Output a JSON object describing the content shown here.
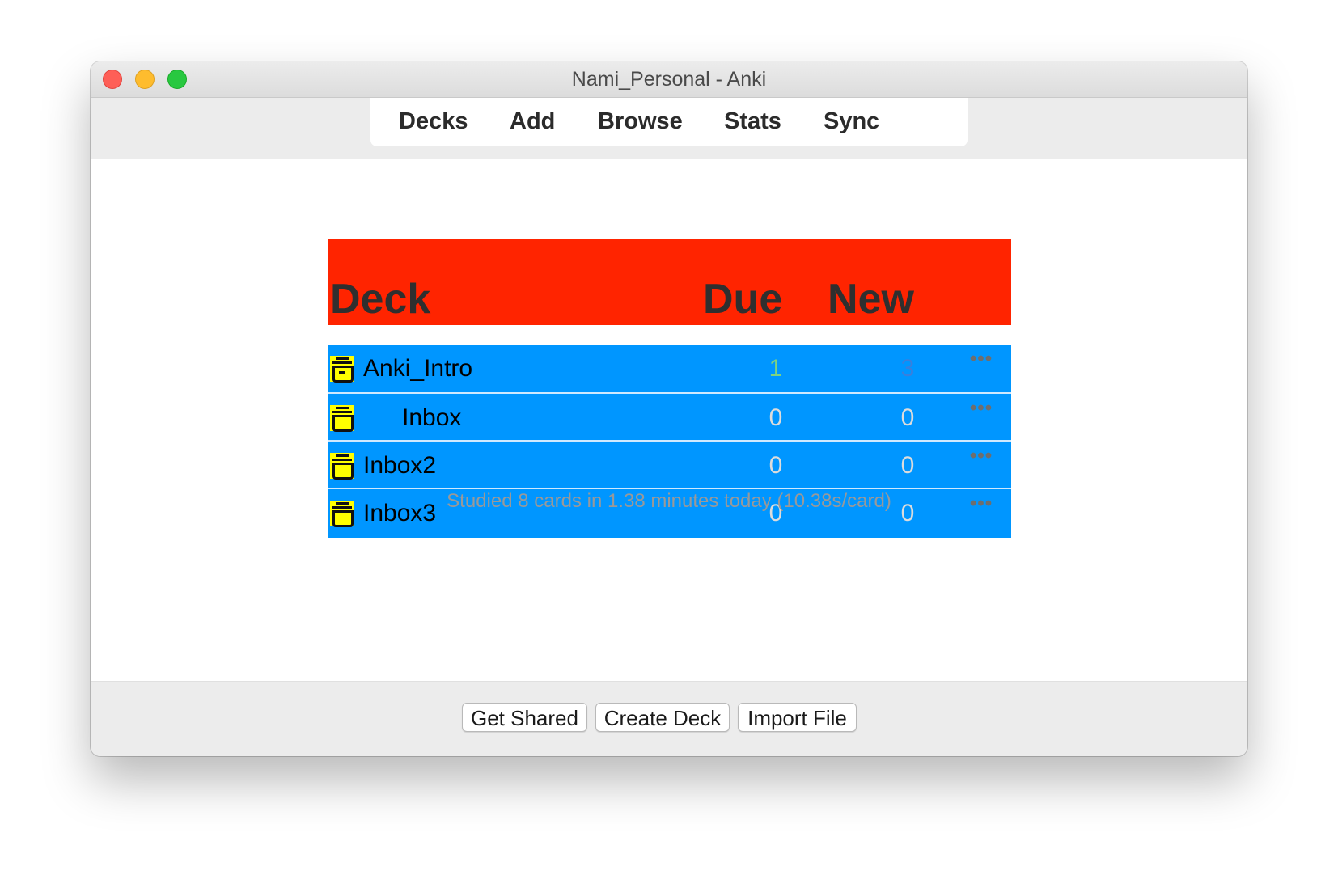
{
  "window": {
    "title": "Nami_Personal - Anki"
  },
  "toolbar": {
    "items": [
      {
        "label": "Decks"
      },
      {
        "label": "Add"
      },
      {
        "label": "Browse"
      },
      {
        "label": "Stats"
      },
      {
        "label": "Sync"
      }
    ]
  },
  "deck_table": {
    "headers": {
      "deck": "Deck",
      "due": "Due",
      "new": "New"
    },
    "header_bg_color": "#ff2400",
    "row_bg_color": "#0096ff",
    "icon_color": "#ffff00",
    "rows": [
      {
        "name": "Anki_Intro",
        "due": "1",
        "new": "3",
        "due_color": "#7fd37f",
        "new_color": "#3a7fdc",
        "options_icon": "ellipsis-icon"
      },
      {
        "name": "Inbox",
        "due": "0",
        "new": "0",
        "due_color": "#dcdcdc",
        "new_color": "#dcdcdc",
        "options_icon": "ellipsis-icon"
      },
      {
        "name": "Inbox2",
        "due": "0",
        "new": "0",
        "due_color": "#dcdcdc",
        "new_color": "#dcdcdc",
        "options_icon": "ellipsis-icon"
      },
      {
        "name": "Inbox3",
        "due": "0",
        "new": "0",
        "due_color": "#dcdcdc",
        "new_color": "#dcdcdc",
        "options_icon": "ellipsis-icon"
      }
    ],
    "options_glyph": "•••"
  },
  "stats": {
    "studied_text": "Studied 8 cards in 1.38 minutes today (10.38s/card)"
  },
  "bottom_bar": {
    "get_shared": "Get Shared",
    "create_deck": "Create Deck",
    "import_file": "Import File"
  }
}
